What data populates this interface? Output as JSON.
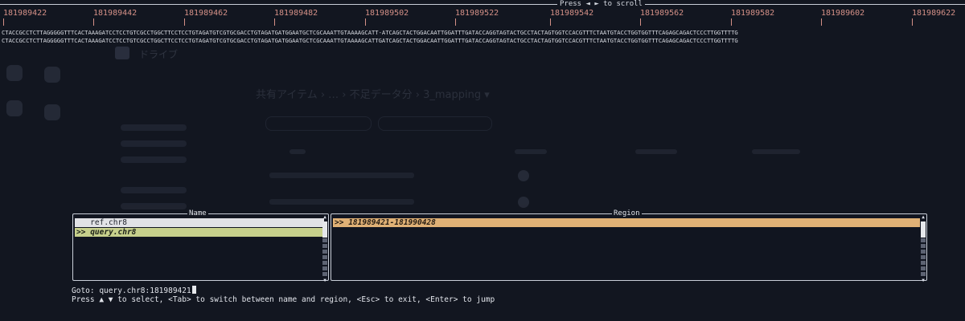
{
  "scroll_hint": "Press ◄ ► to scroll",
  "ruler": {
    "labels": [
      "181989422",
      "181989442",
      "181989462",
      "181989482",
      "181989502",
      "181989522",
      "181989542",
      "181989562",
      "181989582",
      "181989602",
      "181989622"
    ]
  },
  "sequences": {
    "ref": "CTACCGCCTCTTAGGGGGTTTCACTAAAGATCCTCCTGTCGCCTGGCTTCCTCCTGTAGATGTCGTGCGACCTGTAGATGATGGAATGCTCGCAAATTGTAAAAGCATT-ATCAGCTACTGGACAATTGGATTTGATACCAGGTAGTACTGCCTACTAGTGGTCCACGTTTCTAATGTACCTGGTGGTTTCAGAGCAGACTCCCTTGGTTTTG",
    "query": "CTACCGCCTCTTAGGGGGTTTCACTAAAGATCCTCCTGTCGCCTGGCTTCCTCCTGTAGATGTCGTGCGACCTGTAGATGATGGAATGCTCGCAAATTGTAAAAGCATTGATCAGCTACTGGACAATTGGATTTGATACCAGGTAGTACTGCCTACTAGTGGTCCACGTTTCTAATGTACCTGGTGGTTTCAGAGCAGACTCCCTTGGTTTTG"
  },
  "name_panel": {
    "title": "Name",
    "items": [
      {
        "label": "ref.chr8",
        "prefix": ""
      },
      {
        "label": "query.chr8",
        "prefix": ">>"
      }
    ]
  },
  "region_panel": {
    "title": "Region",
    "items": [
      {
        "label": "181989421-181990428",
        "prefix": ">>"
      }
    ]
  },
  "goto": {
    "prompt": "Goto: query.chr8:181989421"
  },
  "help": "Press ▲ ▼ to select, <Tab> to switch between name and region, <Esc> to exit, <Enter> to jump",
  "background_app": {
    "brand": "ドライブ",
    "breadcrumb": "共有アイテム  ›  …  ›  不足データ分  ›  3_mapping ▾"
  },
  "colors": {
    "background": "#121620",
    "ruler": "#d49087",
    "name_selected_bg": "#c7d08c",
    "name_row_bg": "#e1e2e6",
    "region_selected_bg": "#e0b176"
  }
}
